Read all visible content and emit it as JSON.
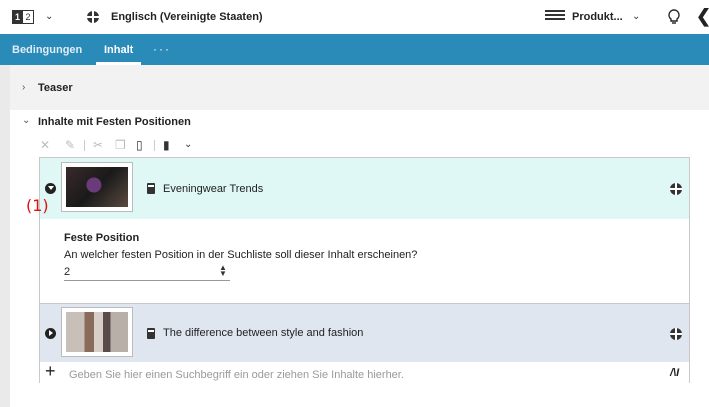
{
  "topbar": {
    "version_icon_a": "1",
    "version_icon_b": "2",
    "language": "Englisch (Vereinigte Staaten)",
    "product_label": "Produkt..."
  },
  "tabs": [
    {
      "label": "Bedingungen"
    },
    {
      "label": "Inhalt"
    },
    {
      "label": "···"
    }
  ],
  "sections": {
    "teaser": "Teaser",
    "fixed_positions": "Inhalte mit Festen Positionen"
  },
  "items": [
    {
      "title": "Eveningwear Trends",
      "expanded": true
    },
    {
      "title": "The difference between style and fashion",
      "expanded": false
    }
  ],
  "annotation": "(1)",
  "fixed_position": {
    "title": "Feste Position",
    "question": "An welcher festen Position in der Suchliste soll dieser Inhalt erscheinen?",
    "value": "2"
  },
  "add_row": {
    "placeholder": "Geben Sie hier einen Suchbegriff ein oder ziehen Sie Inhalte hierher."
  },
  "colors": {
    "accent": "#2a8ab8",
    "selected_row": "#dff7f5",
    "row2": "#dfe6f0",
    "annotation": "#dd1111"
  },
  "icons": [
    "version-icon",
    "chevron-down-icon",
    "globe-icon",
    "product-icon",
    "lightbulb-icon",
    "back-icon",
    "close-icon",
    "edit-icon",
    "cut-icon",
    "copy-icon",
    "paste-icon",
    "add-document-icon",
    "document-icon",
    "plus-icon",
    "library-icon"
  ]
}
